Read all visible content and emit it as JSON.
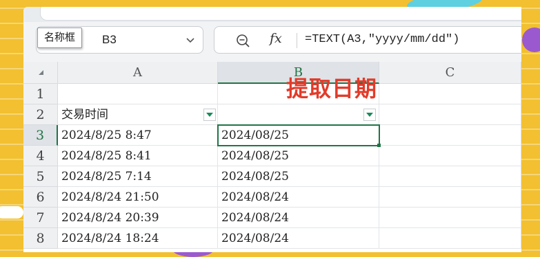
{
  "name_box": {
    "value": "B3",
    "tooltip": "名称框"
  },
  "formula_bar": {
    "fx_label": "fx",
    "formula": "=TEXT(A3,\"yyyy/mm/dd\")"
  },
  "columns": [
    "A",
    "B",
    "C"
  ],
  "rows": [
    "1",
    "2",
    "3",
    "4",
    "5",
    "6",
    "7",
    "8"
  ],
  "cells": {
    "A2": "交易时间",
    "A3": "2024/8/25 8:47",
    "B3": "2024/08/25",
    "A4": "2024/8/25 8:41",
    "B4": "2024/08/25",
    "A5": "2024/8/25 7:14",
    "B5": "2024/08/25",
    "A6": "2024/8/24 21:50",
    "B6": "2024/08/24",
    "A7": "2024/8/24 20:39",
    "B7": "2024/08/24",
    "A8": "2024/8/24 18:24",
    "B8": "2024/08/24"
  },
  "annotation": "提取日期",
  "colors": {
    "accent": "#217346",
    "annotation": "#e23b2a",
    "background": "#f2c030",
    "filter_arrow": "#1c8a5c"
  }
}
